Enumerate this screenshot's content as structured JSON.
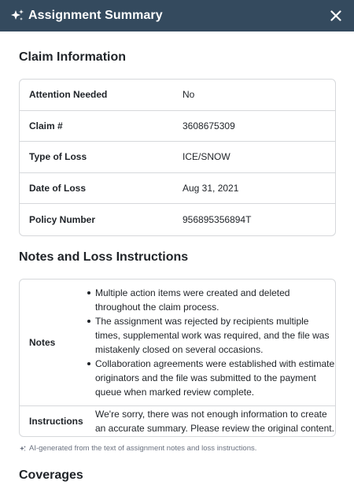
{
  "header": {
    "title": "Assignment Summary",
    "icon": "sparkle-icon",
    "close_icon": "close-icon",
    "bg_color": "#344a5e"
  },
  "claim_information": {
    "title": "Claim Information",
    "rows": [
      {
        "label": "Attention Needed",
        "value": "No"
      },
      {
        "label": "Claim #",
        "value": "3608675309"
      },
      {
        "label": "Type of Loss",
        "value": "ICE/SNOW"
      },
      {
        "label": "Date of Loss",
        "value": "Aug 31, 2021"
      },
      {
        "label": "Policy Number",
        "value": "956895356894T"
      }
    ]
  },
  "notes_section": {
    "title": "Notes and Loss Instructions",
    "notes_label": "Notes",
    "notes": [
      "Multiple action items were created and deleted throughout the claim process.",
      "The assignment was rejected by recipients multiple times, supplemental work was required, and the file was mistakenly closed on several occasions.",
      "Collaboration agreements were established with estimate originators and the file was submitted to the payment queue when marked review complete."
    ],
    "instructions_label": "Instructions",
    "instructions": "We're sorry, there was not enough information to create an accurate summary. Please review the original content."
  },
  "ai_note": "AI-generated from the text of assignment notes and loss instructions.",
  "coverages": {
    "title": "Coverages"
  }
}
